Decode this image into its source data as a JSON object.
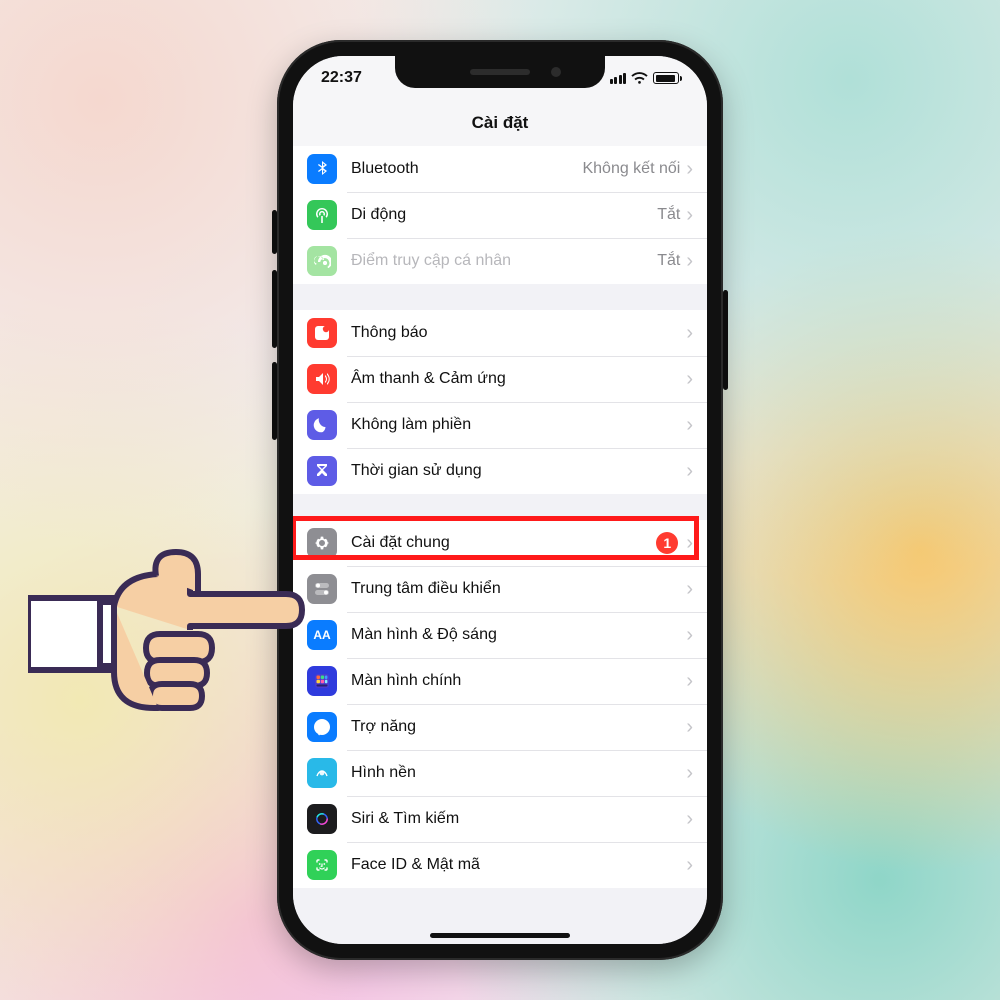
{
  "status": {
    "time": "22:37"
  },
  "header": {
    "title": "Cài đặt"
  },
  "groups": [
    {
      "rows": [
        {
          "id": "bluetooth",
          "label": "Bluetooth",
          "value": "Không kết nối",
          "icon": "bluetooth",
          "color": "c-blue"
        },
        {
          "id": "cellular",
          "label": "Di động",
          "value": "Tắt",
          "icon": "cellular",
          "color": "c-green"
        },
        {
          "id": "hotspot",
          "label": "Điểm truy cập cá nhân",
          "value": "Tắt",
          "icon": "hotspot",
          "color": "c-greenlt",
          "disabled": true
        }
      ]
    },
    {
      "rows": [
        {
          "id": "notifications",
          "label": "Thông báo",
          "icon": "notification",
          "color": "c-red"
        },
        {
          "id": "sound",
          "label": "Âm thanh & Cảm ứng",
          "icon": "sound",
          "color": "c-red"
        },
        {
          "id": "dnd",
          "label": "Không làm phiền",
          "icon": "moon",
          "color": "c-purple"
        },
        {
          "id": "screentime",
          "label": "Thời gian sử dụng",
          "icon": "hourglass",
          "color": "c-purple"
        }
      ]
    },
    {
      "rows": [
        {
          "id": "general",
          "label": "Cài đặt chung",
          "icon": "gear",
          "color": "c-gray",
          "badge": "1",
          "highlighted": true
        },
        {
          "id": "control",
          "label": "Trung tâm điều khiển",
          "icon": "switches",
          "color": "c-gray"
        },
        {
          "id": "display",
          "label": "Màn hình & Độ sáng",
          "icon": "aa",
          "color": "c-bluea"
        },
        {
          "id": "home",
          "label": "Màn hình chính",
          "icon": "homescreen",
          "color": "c-indigo"
        },
        {
          "id": "accessibility",
          "label": "Trợ năng",
          "icon": "accessibility",
          "color": "c-acc"
        },
        {
          "id": "wallpaper",
          "label": "Hình nền",
          "icon": "wallpaper",
          "color": "c-cyan"
        },
        {
          "id": "siri",
          "label": "Siri & Tìm kiếm",
          "icon": "siri",
          "color": "c-black"
        },
        {
          "id": "faceid",
          "label": "Face ID & Mật mã",
          "icon": "faceid",
          "color": "c-greenf"
        }
      ]
    }
  ]
}
